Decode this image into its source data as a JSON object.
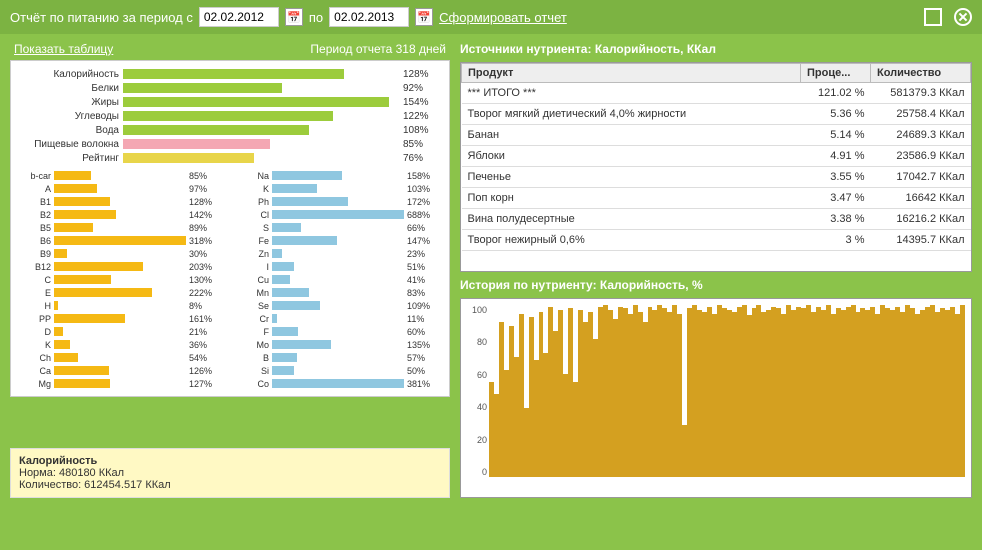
{
  "header": {
    "title": "Отчёт по питанию за период с",
    "date_from": "02.02.2012",
    "to_label": "по",
    "date_to": "02.02.2013",
    "generate": "Сформировать отчет"
  },
  "left": {
    "show_table": "Показать таблицу",
    "period_text": "Период отчета 318 дней"
  },
  "info": {
    "title": "Калорийность",
    "norm": "Норма: 480180 ККал",
    "amount": "Количество: 612454.517 ККал"
  },
  "sources_title": "Источники нутриента: Калорийность, ККал",
  "table": {
    "col_product": "Продукт",
    "col_percent": "Проце...",
    "col_amount": "Количество",
    "rows": [
      {
        "p": "*** ИТОГО ***",
        "pc": "121.02 %",
        "a": "581379.3 ККал"
      },
      {
        "p": "Творог мягкий диетический 4,0% жирности",
        "pc": "5.36 %",
        "a": "25758.4 ККал"
      },
      {
        "p": "Банан",
        "pc": "5.14 %",
        "a": "24689.3 ККал"
      },
      {
        "p": "Яблоки",
        "pc": "4.91 %",
        "a": "23586.9 ККал"
      },
      {
        "p": "Печенье",
        "pc": "3.55 %",
        "a": "17042.7 ККал"
      },
      {
        "p": "Поп корн",
        "pc": "3.47 %",
        "a": "16642 ККал"
      },
      {
        "p": "Вина полудесертные",
        "pc": "3.38 %",
        "a": "16216.2 ККал"
      },
      {
        "p": "Творог нежирный 0,6%",
        "pc": "3 %",
        "a": "14395.7 ККал"
      }
    ]
  },
  "history_title": "История по нутриенту: Калорийность, %",
  "chart_data": {
    "macros": [
      {
        "label": "Калорийность",
        "pct": 128,
        "cls": "gr"
      },
      {
        "label": "Белки",
        "pct": 92,
        "cls": "gr"
      },
      {
        "label": "Жиры",
        "pct": 154,
        "cls": "gr"
      },
      {
        "label": "Углеводы",
        "pct": 122,
        "cls": "gr"
      },
      {
        "label": "Вода",
        "pct": 108,
        "cls": "gr"
      },
      {
        "label": "Пищевые волокна",
        "pct": 85,
        "cls": "pk"
      },
      {
        "label": "Рейтинг",
        "pct": 76,
        "cls": "yl"
      }
    ],
    "micro_left": [
      {
        "l": "b-car",
        "p": 85
      },
      {
        "l": "A",
        "p": 97
      },
      {
        "l": "B1",
        "p": 128
      },
      {
        "l": "B2",
        "p": 142
      },
      {
        "l": "B5",
        "p": 89
      },
      {
        "l": "B6",
        "p": 318
      },
      {
        "l": "B9",
        "p": 30
      },
      {
        "l": "B12",
        "p": 203
      },
      {
        "l": "C",
        "p": 130
      },
      {
        "l": "E",
        "p": 222
      },
      {
        "l": "H",
        "p": 8
      },
      {
        "l": "PP",
        "p": 161
      },
      {
        "l": "D",
        "p": 21
      },
      {
        "l": "K",
        "p": 36
      },
      {
        "l": "Ch",
        "p": 54
      },
      {
        "l": "Ca",
        "p": 126
      },
      {
        "l": "Mg",
        "p": 127
      }
    ],
    "micro_right": [
      {
        "l": "Na",
        "p": 158
      },
      {
        "l": "K",
        "p": 103
      },
      {
        "l": "Ph",
        "p": 172
      },
      {
        "l": "Cl",
        "p": 688
      },
      {
        "l": "S",
        "p": 66
      },
      {
        "l": "Fe",
        "p": 147
      },
      {
        "l": "Zn",
        "p": 23
      },
      {
        "l": "I",
        "p": 51
      },
      {
        "l": "Cu",
        "p": 41
      },
      {
        "l": "Mn",
        "p": 83
      },
      {
        "l": "Se",
        "p": 109
      },
      {
        "l": "Cr",
        "p": 11
      },
      {
        "l": "F",
        "p": 60
      },
      {
        "l": "Mo",
        "p": 135
      },
      {
        "l": "B",
        "p": 57
      },
      {
        "l": "Si",
        "p": 50
      },
      {
        "l": "Co",
        "p": 381
      }
    ],
    "history": {
      "type": "bar",
      "ylim": [
        0,
        100
      ],
      "yticks": [
        0,
        20,
        40,
        60,
        80,
        100
      ],
      "values": [
        55,
        48,
        90,
        62,
        88,
        70,
        95,
        40,
        93,
        68,
        96,
        72,
        99,
        85,
        97,
        60,
        98,
        55,
        97,
        90,
        96,
        80,
        99,
        100,
        97,
        92,
        99,
        98,
        95,
        100,
        96,
        90,
        99,
        97,
        100,
        98,
        96,
        100,
        95,
        30,
        98,
        100,
        97,
        96,
        99,
        95,
        100,
        98,
        97,
        96,
        99,
        100,
        94,
        98,
        100,
        96,
        97,
        99,
        98,
        95,
        100,
        97,
        99,
        98,
        100,
        96,
        99,
        97,
        100,
        95,
        98,
        97,
        99,
        100,
        96,
        98,
        97,
        99,
        95,
        100,
        98,
        97,
        99,
        96,
        100,
        98,
        95,
        97,
        99,
        100,
        96,
        98,
        97,
        99,
        95,
        100
      ]
    }
  }
}
